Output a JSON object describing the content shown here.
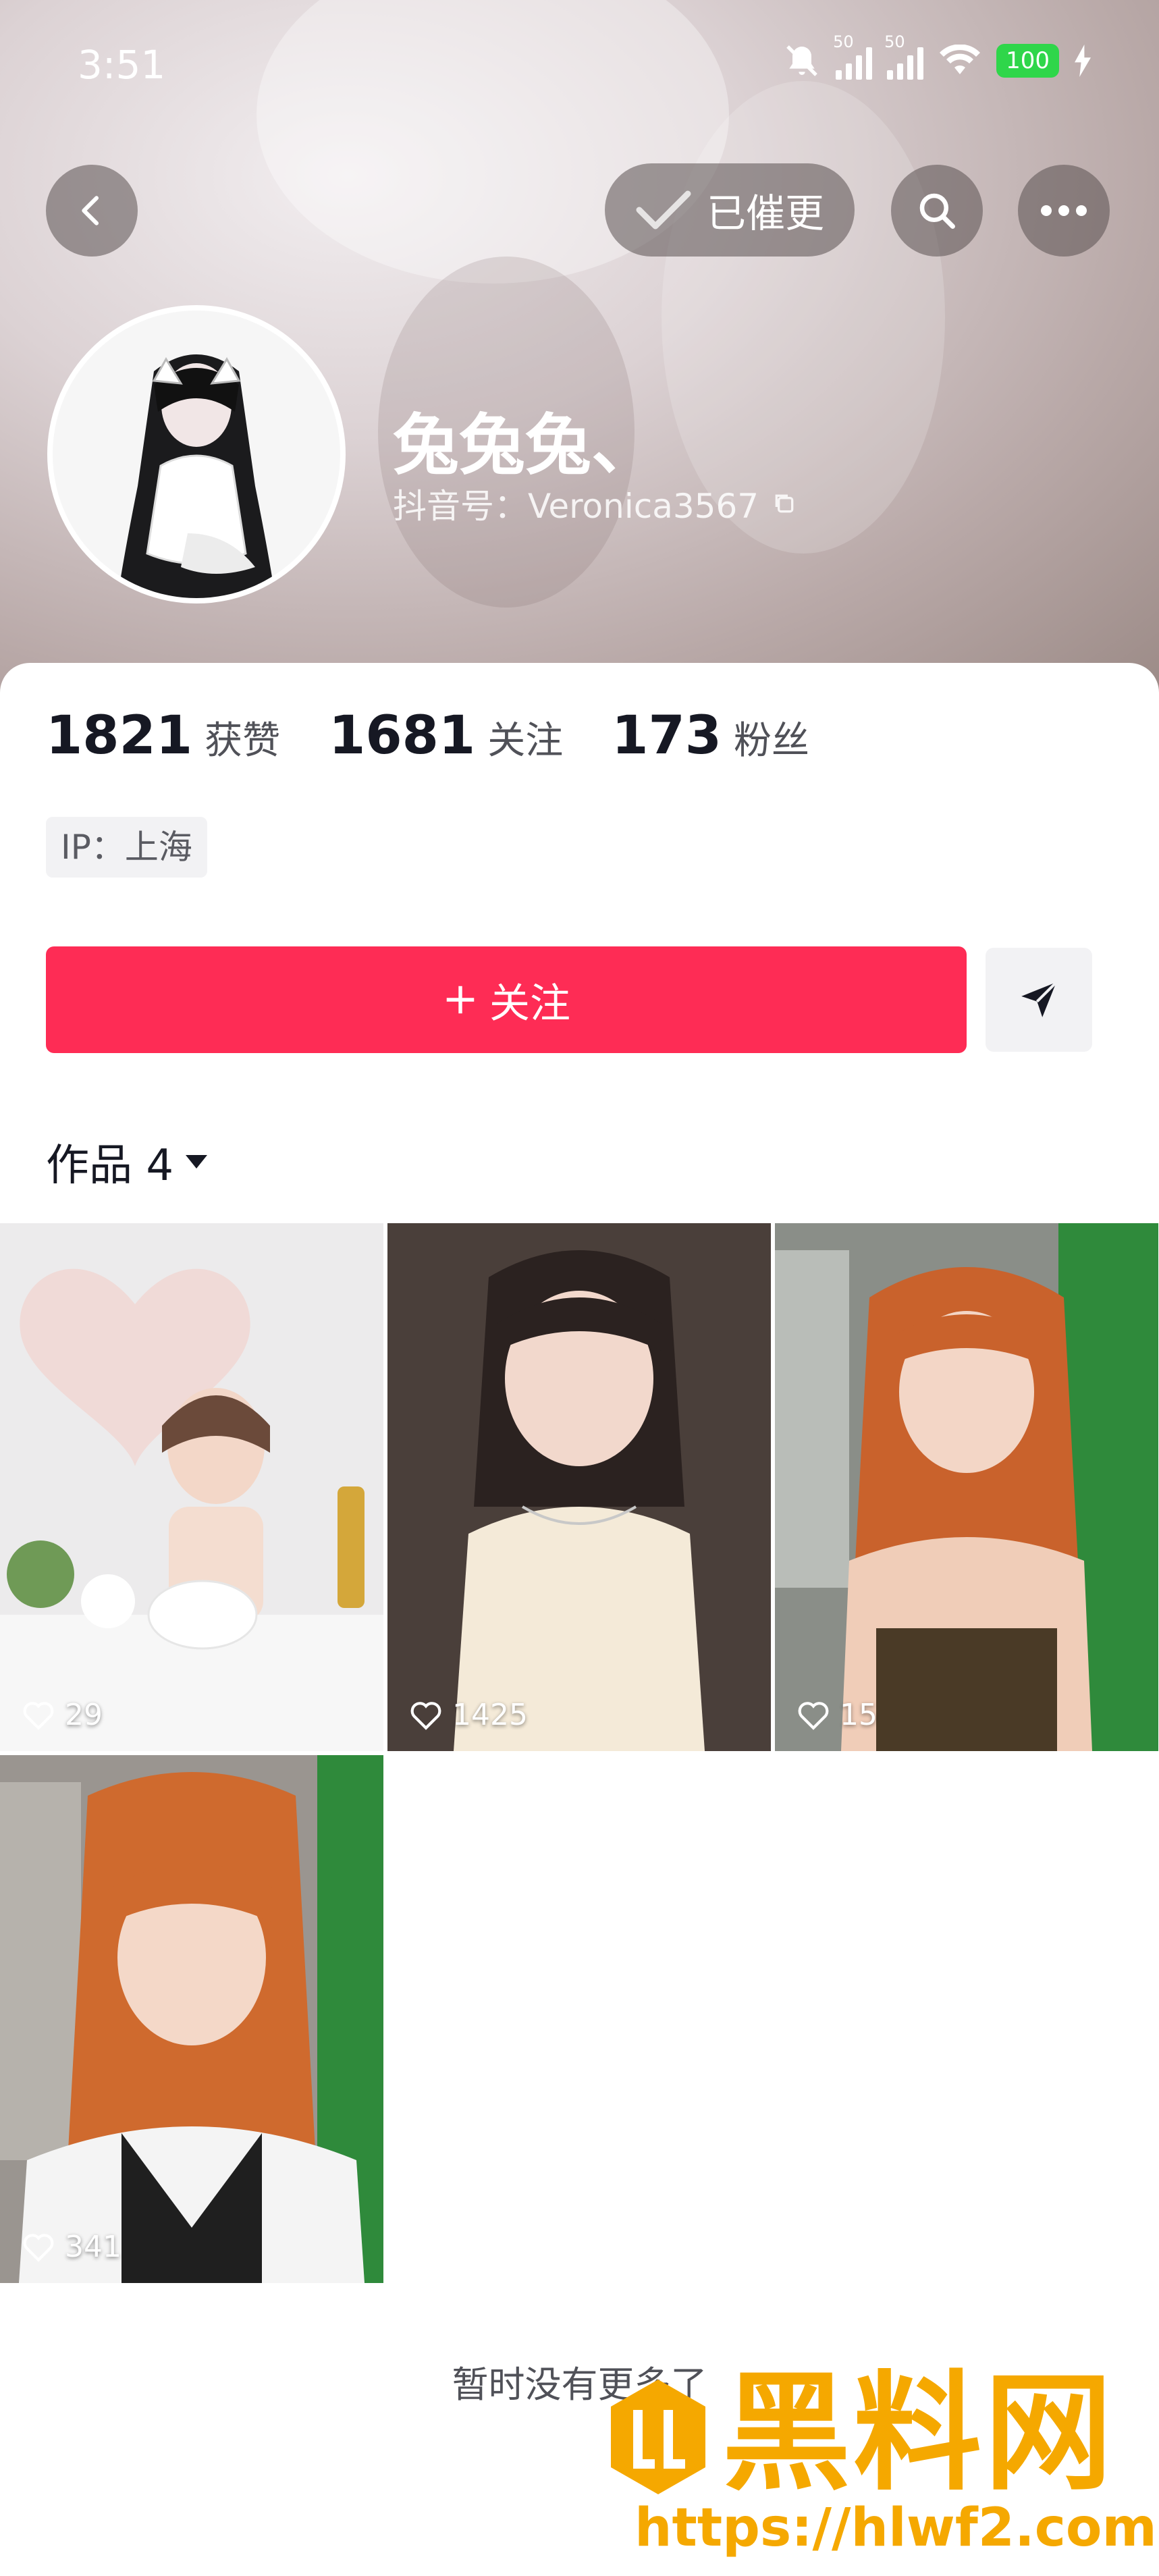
{
  "status_bar": {
    "time": "3:51",
    "signal1_label": "50",
    "signal2_label": "50",
    "battery": "100"
  },
  "header": {
    "reminded_label": "已催更"
  },
  "profile": {
    "nickname": "兔兔兔、",
    "douyin_id_label": "抖音号：Veronica3567",
    "stats": [
      {
        "value": "1821",
        "label": "获赞"
      },
      {
        "value": "1681",
        "label": "关注"
      },
      {
        "value": "173",
        "label": "粉丝"
      }
    ],
    "ip": "IP：上海"
  },
  "actions": {
    "follow_label": "关注"
  },
  "works": {
    "title": "作品 4",
    "items": [
      {
        "likes": "29"
      },
      {
        "likes": "1425"
      },
      {
        "likes": "15"
      },
      {
        "likes": "341"
      }
    ],
    "end_text": "暂时没有更多了"
  },
  "watermark": {
    "title": "黑料网",
    "url": "https://hlwf2.com"
  },
  "colors": {
    "accent": "#fe2c55",
    "watermark": "#f5a800"
  }
}
